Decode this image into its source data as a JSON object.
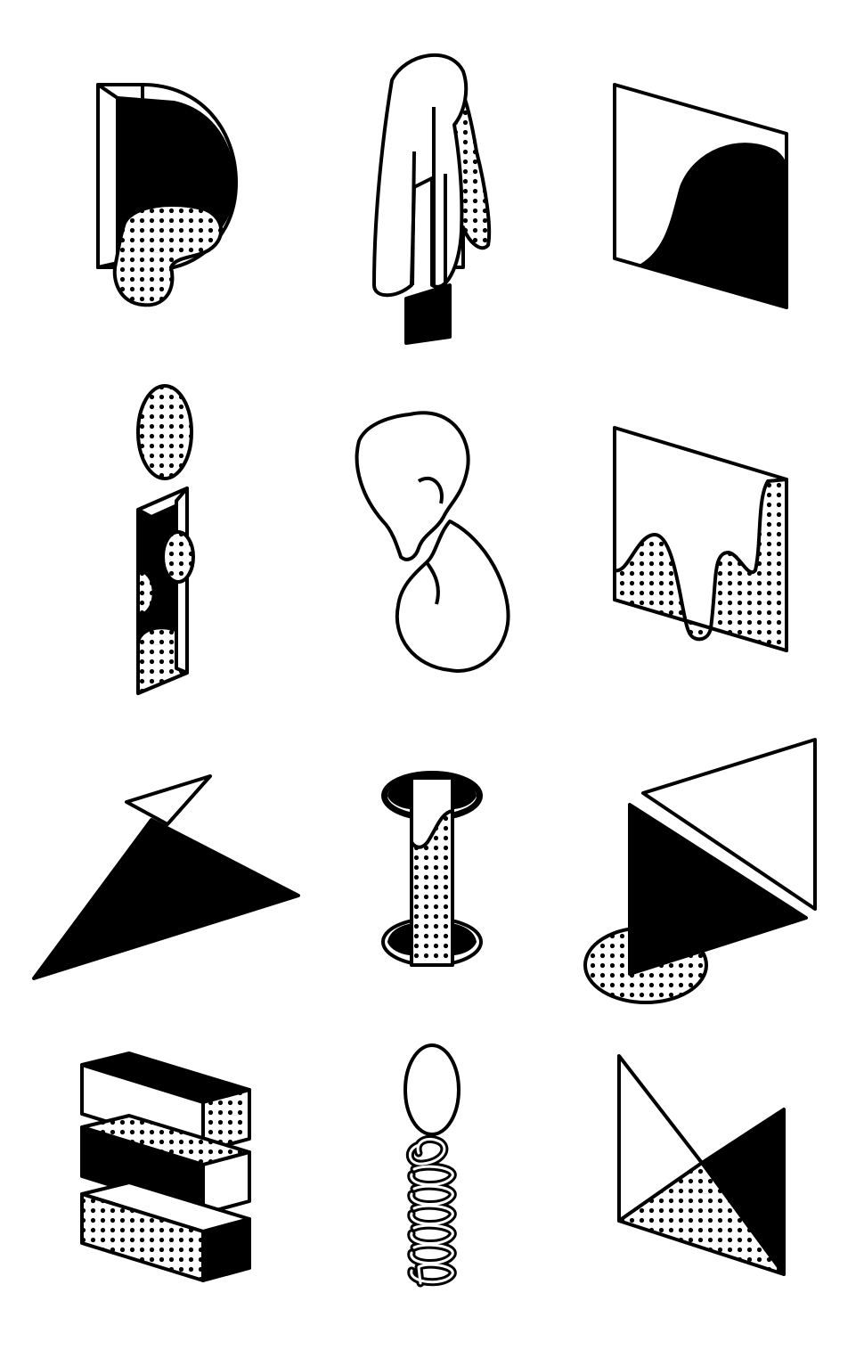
{
  "sheet": {
    "background": "#ffffff",
    "ink": "#000000",
    "paper": "#ffffff",
    "pattern": "halftone-dots"
  },
  "glyphs": [
    {
      "icon": "letter-d-icon"
    },
    {
      "icon": "letter-r-towel-icon"
    },
    {
      "icon": "wave-panel-icon"
    },
    {
      "icon": "letter-i-icon"
    },
    {
      "icon": "linked-drops-icon"
    },
    {
      "icon": "dripping-panel-icon"
    },
    {
      "icon": "triangles-icon"
    },
    {
      "icon": "pipe-in-holes-icon"
    },
    {
      "icon": "triangle-panels-icon"
    },
    {
      "icon": "stacked-bars-icon"
    },
    {
      "icon": "coil-icon"
    },
    {
      "icon": "bowtie-panel-icon"
    }
  ]
}
